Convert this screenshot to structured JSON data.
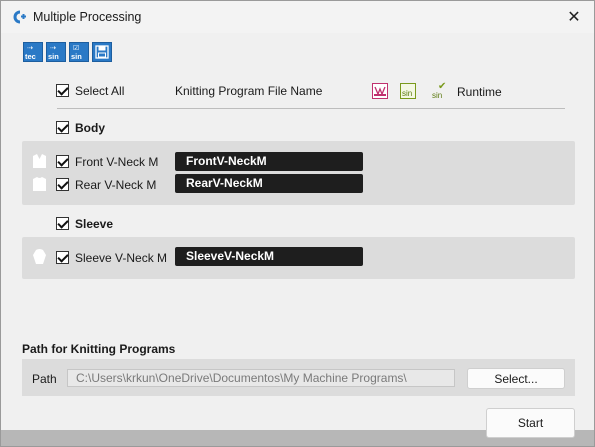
{
  "window": {
    "title": "Multiple Processing",
    "close_glyph": "✕"
  },
  "toolbar": [
    {
      "name": "tec-button",
      "top": "⇢",
      "label": "tec"
    },
    {
      "name": "sin-button",
      "top": "⇢",
      "label": "sin"
    },
    {
      "name": "sin-check-button",
      "top": "☑",
      "label": "sin"
    },
    {
      "name": "save-button",
      "top": "",
      "label": ""
    }
  ],
  "header": {
    "select_all": "Select All",
    "file_name_col": "Knitting Program File Name",
    "runtime": "Runtime",
    "icon_sin_label": "sin"
  },
  "groups": {
    "body": {
      "label": "Body",
      "items": [
        {
          "label": "Front V-Neck M",
          "file": "FrontV-NeckM"
        },
        {
          "label": "Rear V-Neck M",
          "file": "RearV-NeckM"
        }
      ]
    },
    "sleeve": {
      "label": "Sleeve",
      "items": [
        {
          "label": "Sleeve V-Neck M",
          "file": "SleeveV-NeckM"
        }
      ]
    }
  },
  "path_section": {
    "heading": "Path for Knitting Programs",
    "label": "Path",
    "value": "C:\\Users\\krkun\\OneDrive\\Documentos\\My Machine Programs\\",
    "select_button": "Select..."
  },
  "start_button": "Start",
  "colors": {
    "accent": "#2a79c6",
    "knit_icon": "#c0306e",
    "sin_icon": "#7a9a1c",
    "name_box": "#1e1e1e",
    "panel": "#dcdcdc"
  }
}
